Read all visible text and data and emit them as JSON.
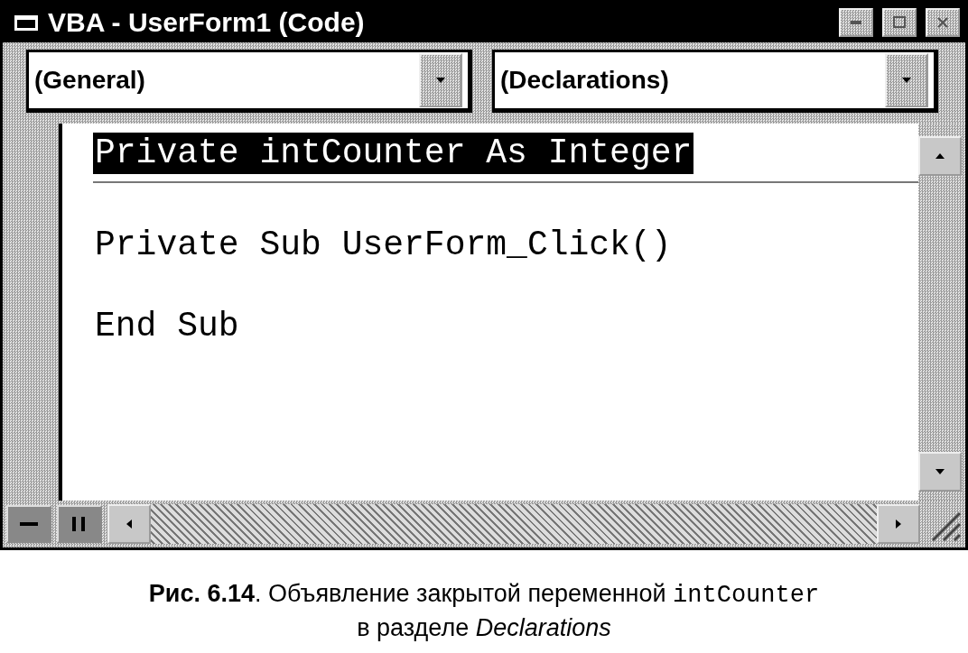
{
  "window": {
    "title": "VBA - UserForm1 (Code)"
  },
  "object_box": {
    "value": "(General)"
  },
  "procedure_box": {
    "value": "(Declarations)"
  },
  "code_lines": [
    {
      "text": "Private intCounter As Integer",
      "selected": true,
      "separator_after": true
    },
    {
      "text": "Private Sub UserForm_Click()",
      "selected": false,
      "separator_after": false
    },
    {
      "text": "End Sub",
      "selected": false,
      "separator_after": false
    }
  ],
  "caption": {
    "lines": [
      {
        "text": "**Рис. 6.14**. Объявление закрытой переменной ",
        "code": "intCounter"
      },
      {
        "text": "в разделе *Declarations*"
      }
    ]
  }
}
